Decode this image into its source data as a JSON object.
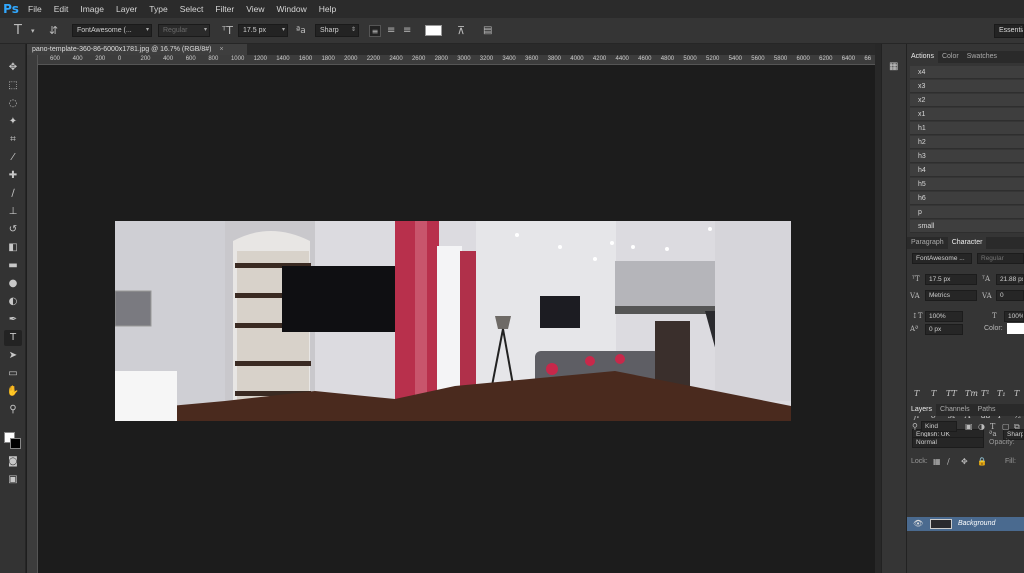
{
  "app": {
    "logo": "Ps"
  },
  "menu": [
    "File",
    "Edit",
    "Image",
    "Layer",
    "Type",
    "Select",
    "Filter",
    "View",
    "Window",
    "Help"
  ],
  "options": {
    "font_family": "FontAwesome (...",
    "font_style": "Regular",
    "font_size": "17.5 px",
    "antialias": "Sharp",
    "workspace": "Essentials"
  },
  "document": {
    "tab_title": "pano-template-360-86-6000x1781.jpg @ 16.7% (RGB/8#)",
    "close": "×",
    "ruler_ticks": [
      "600",
      "400",
      "200",
      "0",
      "200",
      "400",
      "600",
      "800",
      "1000",
      "1200",
      "1400",
      "1600",
      "1800",
      "2000",
      "2200",
      "2400",
      "2600",
      "2800",
      "3000",
      "3200",
      "3400",
      "3600",
      "3800",
      "4000",
      "4200",
      "4400",
      "4600",
      "4800",
      "5000",
      "5200",
      "5400",
      "5600",
      "5800",
      "6000",
      "6200",
      "6400",
      "66"
    ]
  },
  "panels": {
    "top_tabs": [
      "Actions",
      "Color",
      "Swatches"
    ],
    "actions": [
      "x4",
      "x3",
      "x2",
      "x1",
      "h1",
      "h2",
      "h3",
      "h4",
      "h5",
      "h6",
      "p",
      "small"
    ],
    "char_tabs": [
      "Paragraph",
      "Character"
    ],
    "character": {
      "font": "FontAwesome ...",
      "style": "Regular",
      "size": "17.5 px",
      "leading": "21.88 px",
      "kerning": "Metrics",
      "tracking": "0",
      "vscale": "100%",
      "hscale": "100%",
      "baseline": "0 px",
      "color_label": "Color:",
      "language": "English: UK",
      "aa": "Sharp"
    },
    "layer_tabs": [
      "Layers",
      "Channels",
      "Paths"
    ],
    "layers": {
      "filter": "Kind",
      "blend": "Normal",
      "opacity_label": "Opacity:",
      "lock_label": "Lock:",
      "fill_label": "Fill:",
      "items": [
        {
          "name": "Background"
        }
      ]
    }
  }
}
